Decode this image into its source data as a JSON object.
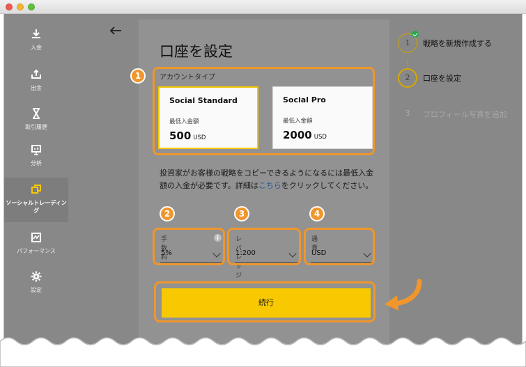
{
  "window": {
    "controls": [
      "close",
      "minimize",
      "maximize"
    ]
  },
  "sidebar": {
    "items": [
      {
        "label": "入金",
        "icon": "deposit-icon"
      },
      {
        "label": "出金",
        "icon": "withdraw-icon"
      },
      {
        "label": "取引履歴",
        "icon": "hourglass-icon"
      },
      {
        "label": "分析",
        "icon": "presentation-chart-icon"
      },
      {
        "label": "ソーシャルトレーディング",
        "icon": "copy-icon",
        "active": true
      },
      {
        "label": "パフォーマンス",
        "icon": "chart-line-icon"
      },
      {
        "label": "設定",
        "icon": "gear-icon"
      }
    ]
  },
  "main": {
    "back_icon": "arrow-left-icon",
    "title": "口座を設定",
    "account_type_label": "アカウントタイプ",
    "accounts": [
      {
        "name": "Social Standard",
        "min_label": "最低入金額",
        "amount": "500",
        "currency": "USD",
        "selected": true
      },
      {
        "name": "Social Pro",
        "min_label": "最低入金額",
        "amount": "2000",
        "currency": "USD",
        "selected": false
      }
    ],
    "description_before": "投資家がお客様の戦略をコピーできるようになるには最低入金額の入金が必要です。詳細は",
    "description_link": "こちら",
    "description_after": "をクリックしてください。",
    "fields": {
      "fee": {
        "label": "手数料",
        "value": "5%"
      },
      "leverage": {
        "label": "レバレッジ",
        "value": "1:200"
      },
      "currency": {
        "label": "通貨",
        "value": "USD"
      }
    },
    "continue_label": "続行"
  },
  "stepper": [
    {
      "number": "1",
      "label": "戦略を新規作成する",
      "state": "done"
    },
    {
      "number": "2",
      "label": "口座を設定",
      "state": "current"
    },
    {
      "number": "3",
      "label": "プロフィール写真を追加",
      "state": "upcoming"
    }
  ],
  "callouts": [
    "1",
    "2",
    "3",
    "4"
  ],
  "colors": {
    "accent": "#f8c900",
    "callout": "#f0962c",
    "link": "#2a5d9a",
    "success": "#27a84a"
  }
}
